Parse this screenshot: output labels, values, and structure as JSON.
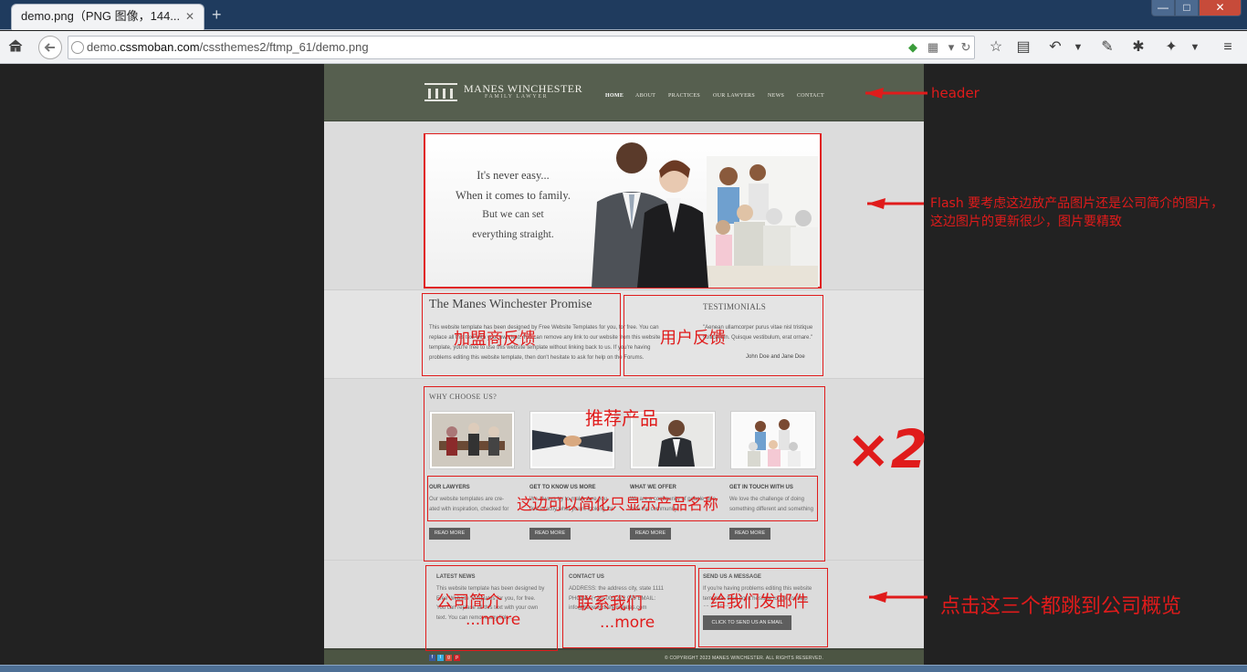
{
  "browser": {
    "tab_title": "demo.png（PNG 图像，144...",
    "tab_close": "✕",
    "new_tab": "+",
    "url_host": "demo.cssmoban.com",
    "url_prefix": "demo.",
    "url_path": "/cssthemes2/ftmp_61/demo.png",
    "win_min": "—",
    "win_max": "□",
    "win_close": "✕",
    "icons": [
      "home-icon",
      "back-icon",
      "bookmark-star-icon",
      "reading-list-icon",
      "undo-icon",
      "dropdown-icon",
      "tools-wrench-icon",
      "settings-gear-icon",
      "addon-icon",
      "dropdown-icon",
      "menu-hamburger-icon"
    ]
  },
  "site": {
    "logo_name": "MANES WINCHESTER",
    "logo_sub": "FAMILY LAWYER",
    "menu": [
      "HOME",
      "ABOUT",
      "PRACTICES",
      "OUR LAWYERS",
      "NEWS",
      "CONTACT"
    ],
    "hero": [
      "It's never easy...",
      "When it comes to family.",
      "But we can set",
      "everything straight."
    ],
    "promise_title": "The Manes Winchester Promise",
    "promise_text": "This website template has been designed by Free Website Templates for you, for free. You can replace all this text with your own text. You can remove any link to our website from this website template, you're free to use this website template without linking back to us. If you're having problems editing this website template, then don't hesitate to ask for help on the Forums.",
    "testi_title": "TESTIMONIALS",
    "testi_text": "\"Aenean ullamcorper purus vitae nisl tristique sollicitudin. Quisque vestibulum, erat ornare.\"",
    "testi_author": "John Doe and Jane Doe",
    "why_title": "WHY CHOOSE US?",
    "columns": [
      {
        "title": "OUR LAWYERS",
        "text": "Our website templates are cre- ated with inspiration, checked for quality, and originality."
      },
      {
        "title": "GET TO KNOW US MORE",
        "text": "We always try to make sure you find exactly what you're looking for."
      },
      {
        "title": "WHAT WE OFFER",
        "text": "We are a community of people who love the community."
      },
      {
        "title": "GET IN TOUCH WITH US",
        "text": "We love the challenge of doing something different and something special."
      }
    ],
    "read_more": "READ MORE",
    "latest_title": "LATEST NEWS",
    "latest_text": "This website template has been designed by Free Website Templates for you, for free. You can replace all this text with your own text. You can remove any link...",
    "contact_title": "CONTACT US",
    "contact_text": "ADDRESS: the address city, state 1111 PHONE: (+20) 000 222 999 EMAIL: info@freewebsitetemplates.com",
    "send_title": "SEND US A MESSAGE",
    "send_text": "If you're having problems editing this website template, then don't hesitate to ask for help on the Forums.",
    "send_button": "CLICK TO SEND US AN EMAIL",
    "copyright": "© COPYRIGHT 2023 MANES WINCHESTER. ALL RIGHTS RESERVED.",
    "social": [
      "f",
      "t",
      "g",
      "p"
    ]
  },
  "annotations": {
    "header": "header",
    "flash": "Flash 要考虑这边放产品图片还是公司简介的图片，这边图片的更新很少，图片要精致",
    "franchise": "加盟商反馈",
    "user_feedback": "用户反馈",
    "recommend": "推荐产品",
    "times_two": "×2",
    "simplify": "这边可以简化只显示产品名称",
    "company_intro": "公司简介",
    "contact_us": "联系我们",
    "email_us": "给我们发邮件",
    "more1": "...more",
    "more2": "...more",
    "click_all": "点击这三个都跳到公司概览"
  },
  "colors": {
    "annotation": "#e01b1b",
    "site_header": "#565f4f"
  }
}
